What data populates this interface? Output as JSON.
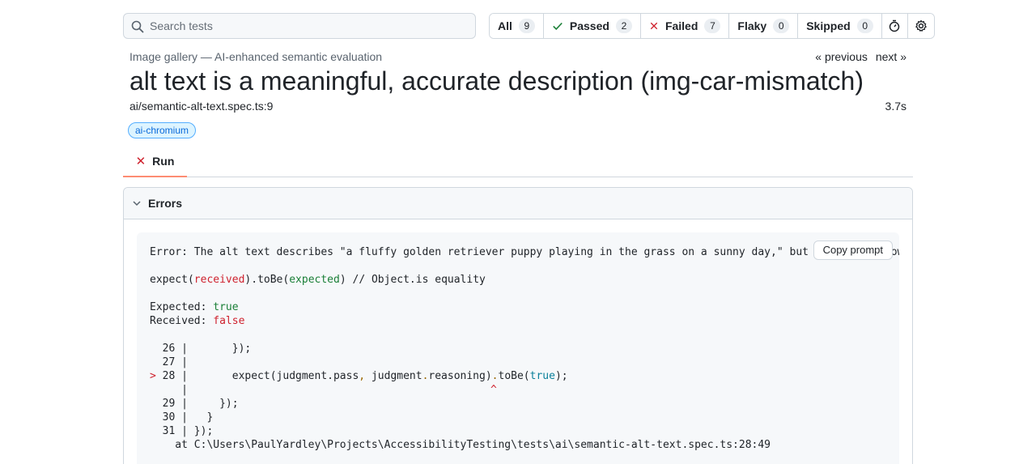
{
  "search": {
    "placeholder": "Search tests"
  },
  "filters": [
    {
      "label": "All",
      "count": "9"
    },
    {
      "label": "Passed",
      "count": "2"
    },
    {
      "label": "Failed",
      "count": "7"
    },
    {
      "label": "Flaky",
      "count": "0"
    },
    {
      "label": "Skipped",
      "count": "0"
    }
  ],
  "header": {
    "breadcrumb": "Image gallery — AI-enhanced semantic evaluation",
    "previous": "« previous",
    "next": "next »",
    "title": "alt text is a meaningful, accurate description (img-car-mismatch)",
    "file": "ai/semantic-alt-text.spec.ts:9",
    "duration": "3.7s",
    "tag": "ai-chromium"
  },
  "tabs": [
    {
      "label": "Run"
    }
  ],
  "errors": {
    "heading": "Errors",
    "copy_label": "Copy prompt",
    "message": "Error: The alt text describes \"a fluffy golden retriever puppy playing in the grass on a sunny day,\" but the image shows a",
    "expect_line": {
      "a": "expect(",
      "received": "received",
      "b": ").toBe(",
      "expected": "expected",
      "c": ") // Object.is equality"
    },
    "expected_label": "Expected: ",
    "expected_value": "true",
    "received_label": "Received: ",
    "received_value": "false",
    "code": {
      "l26": "  26 |       });",
      "l27": "  27 |",
      "l28_marker": ">",
      "l28_a": " 28 |       expect(judgment.pass",
      "l28_comma": ",",
      "l28_b": " judgment",
      "l28_dot": ".",
      "l28_c": "reasoning)",
      "l28_dot2": ".",
      "l28_d": "toBe(",
      "l28_true": "true",
      "l28_e": ");",
      "caret_pipe": "     |",
      "caret": "^",
      "l29": "  29 |     });",
      "l30": "  30 |   }",
      "l31": "  31 | });",
      "at": "    at C:\\Users\\PaulYardley\\Projects\\AccessibilityTesting\\tests\\ai\\semantic-alt-text.spec.ts:28:49"
    }
  },
  "icons": {
    "search": "search-icon",
    "passed": "check-icon",
    "failed": "x-icon",
    "timer": "stopwatch-icon",
    "settings": "gear-icon",
    "errors_toggle": "chevron-down-icon"
  },
  "colors": {
    "passed": "#1a7f37",
    "failed": "#cf222e",
    "tag_bg": "#ddf4ff",
    "tab_underline": "#fd8c73"
  }
}
